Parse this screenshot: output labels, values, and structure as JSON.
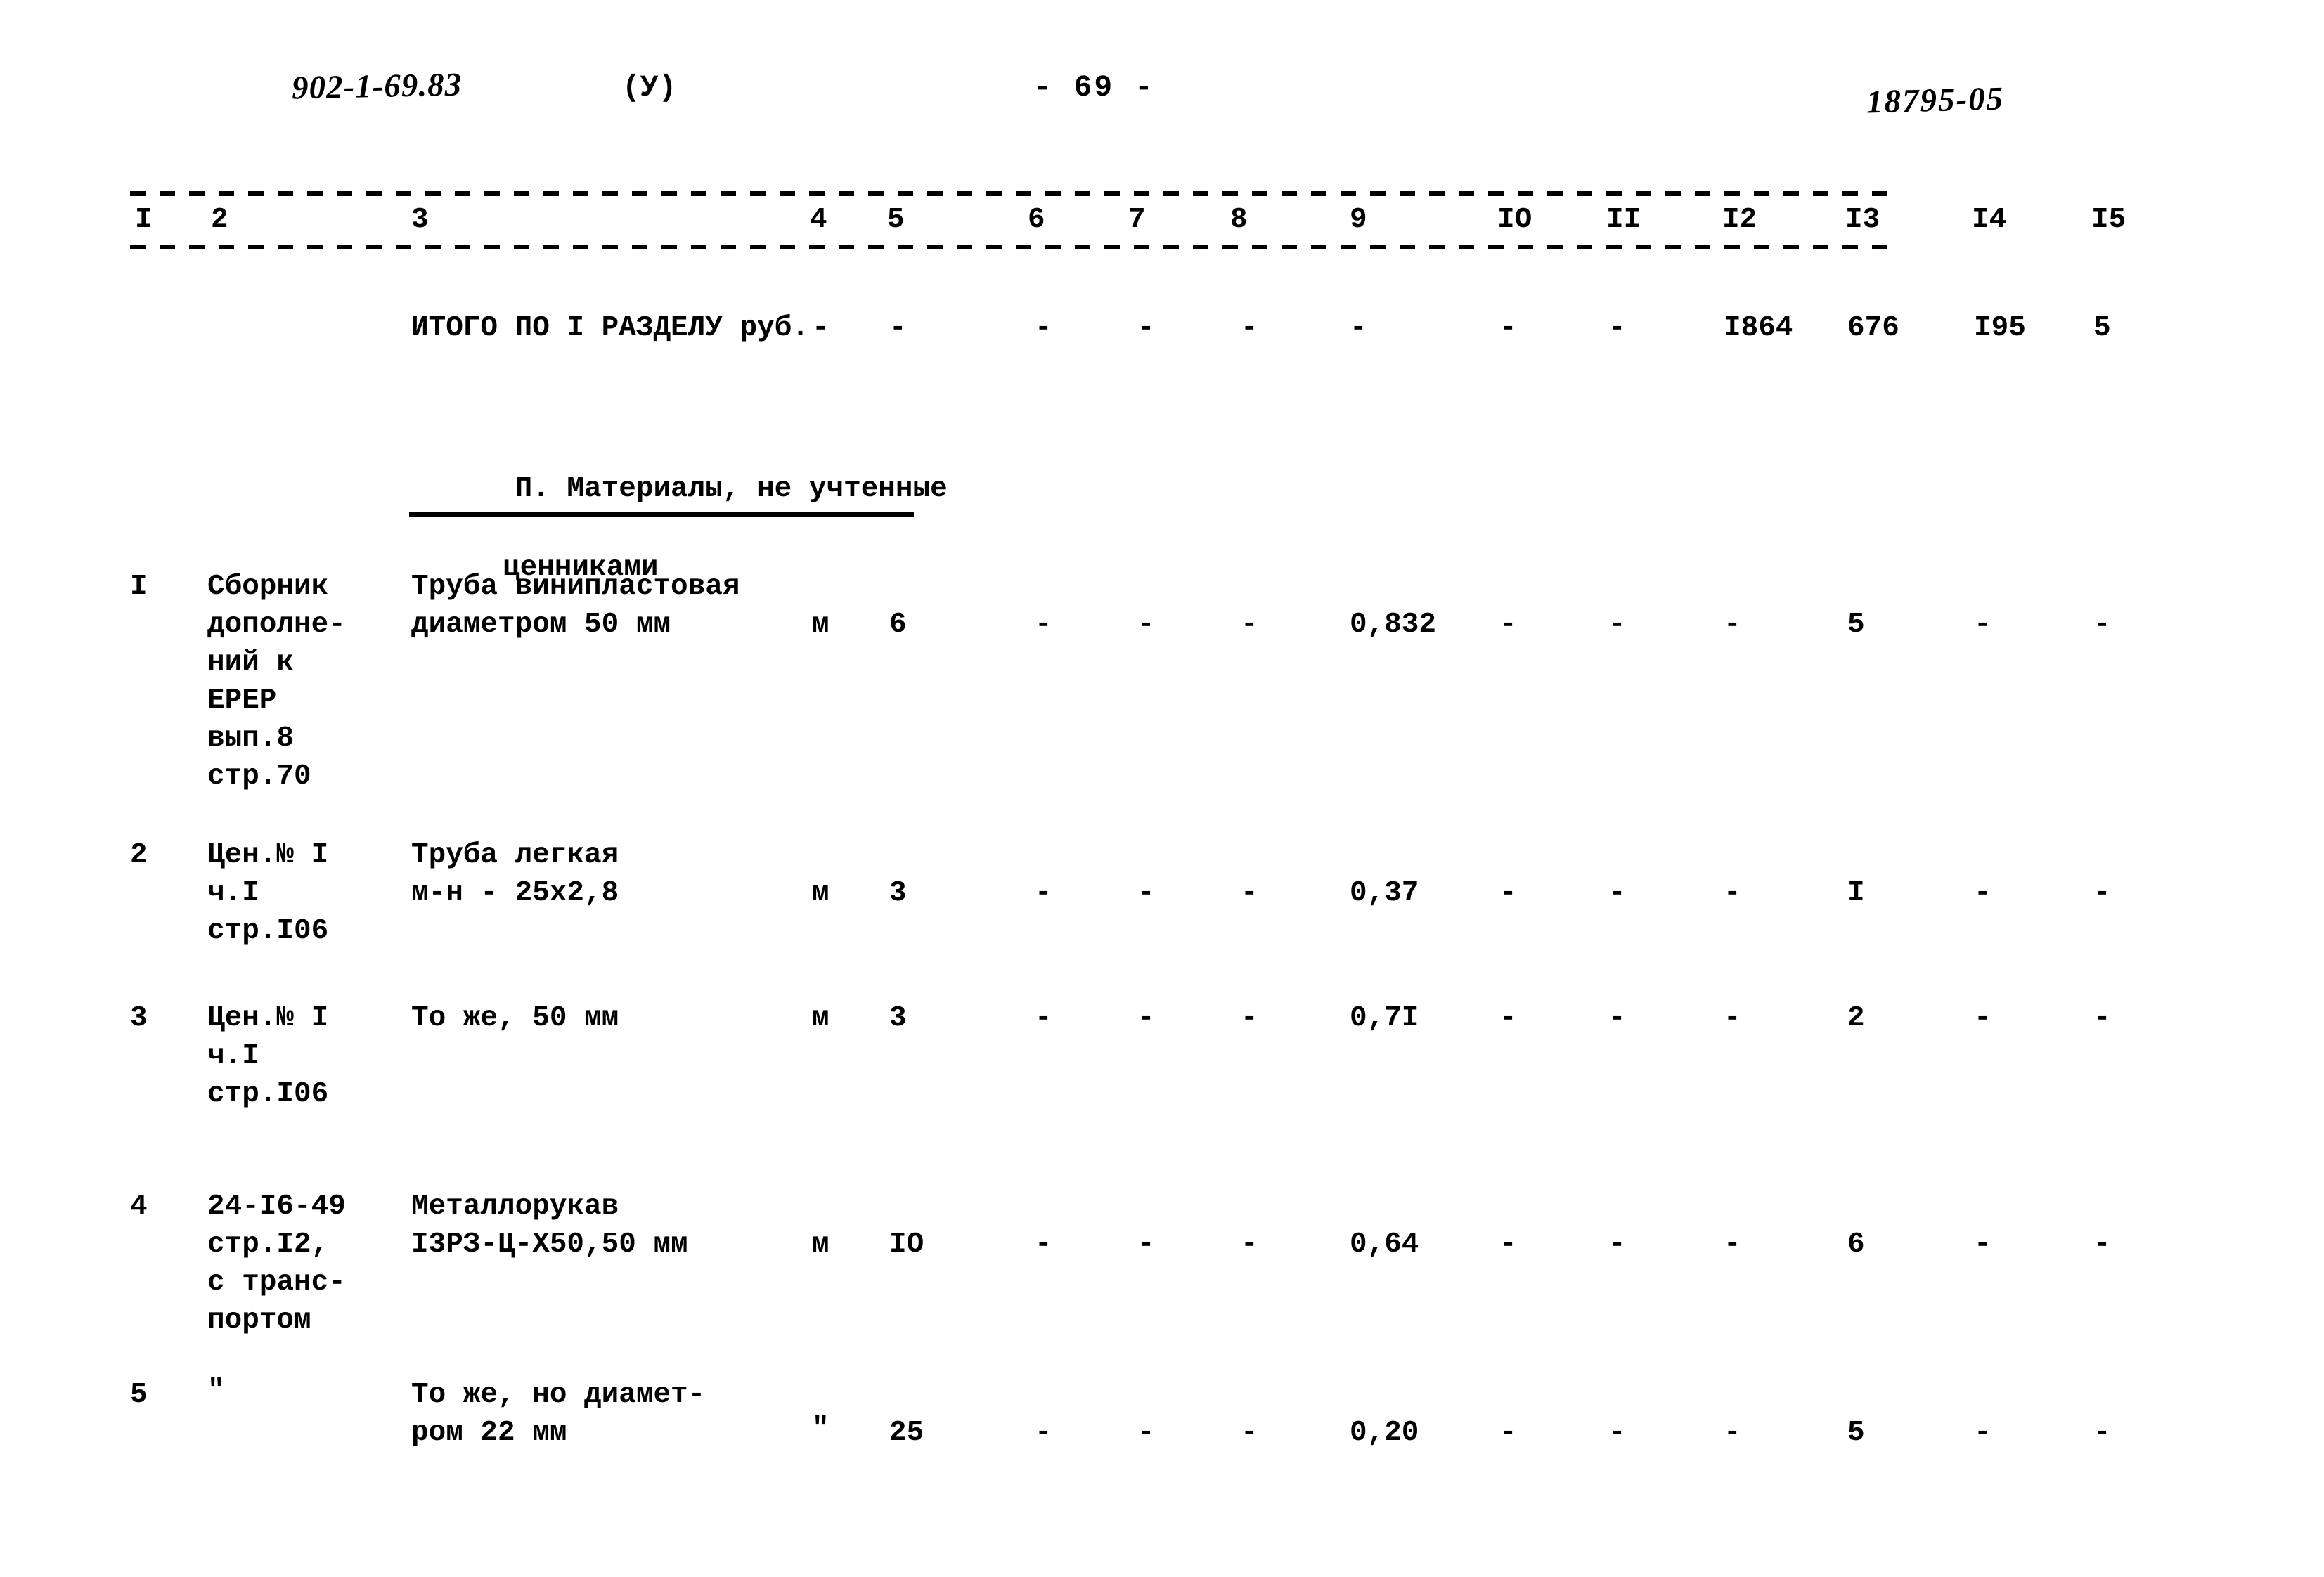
{
  "header": {
    "doc_code": "902-1-69.83",
    "doc_variant": "(У)",
    "page_number": "- 69 -",
    "archive_code": "18795-05"
  },
  "table": {
    "column_numbers": [
      "I",
      "2",
      "3",
      "4",
      "5",
      "6",
      "7",
      "8",
      "9",
      "IO",
      "II",
      "I2",
      "I3",
      "I4",
      "I5"
    ],
    "total_row": {
      "label": "ИТОГО ПО I РАЗДЕЛУ руб.",
      "c4": "-",
      "c5": "-",
      "c6": "-",
      "c7": "-",
      "c8": "-",
      "c9": "-",
      "c10": "-",
      "c11": "-",
      "c12": "I864",
      "c13": "676",
      "c14": "I95",
      "c15": "5"
    },
    "section_heading": {
      "line1": "П. Материалы, не учтенные",
      "line2": "ценниками"
    },
    "rows": [
      {
        "num": "I",
        "code": "Сборник\nдополне-\nний к\nЕРЕР\nвып.8\nстр.70",
        "desc": "Труба винипластовая\nдиаметром 50 мм",
        "unit": "м",
        "qty": "6",
        "c6": "-",
        "c7": "-",
        "c8": "-",
        "c9": "0,832",
        "c10": "-",
        "c11": "-",
        "c12": "-",
        "c13": "5",
        "c14": "-",
        "c15": "-"
      },
      {
        "num": "2",
        "code": "Цен.№ I\nч.I\nстр.I06",
        "desc": "Труба легкая\nм-н - 25х2,8",
        "unit": "м",
        "qty": "3",
        "c6": "-",
        "c7": "-",
        "c8": "-",
        "c9": "0,37",
        "c10": "-",
        "c11": "-",
        "c12": "-",
        "c13": "I",
        "c14": "-",
        "c15": "-"
      },
      {
        "num": "3",
        "code": "Цен.№ I\nч.I\nстр.I06",
        "desc": "То же, 50 мм",
        "unit": "м",
        "qty": "3",
        "c6": "-",
        "c7": "-",
        "c8": "-",
        "c9": "0,7I",
        "c10": "-",
        "c11": "-",
        "c12": "-",
        "c13": "2",
        "c14": "-",
        "c15": "-"
      },
      {
        "num": "4",
        "code": "24-I6-49\nстр.I2,\nс транс-\nпортом",
        "desc": "Металлорукав\nI3РЗ-Ц-Х50,50 мм",
        "unit": "м",
        "qty": "IO",
        "c6": "-",
        "c7": "-",
        "c8": "-",
        "c9": "0,64",
        "c10": "-",
        "c11": "-",
        "c12": "-",
        "c13": "6",
        "c14": "-",
        "c15": "-"
      },
      {
        "num": "5",
        "code": "\"",
        "desc": "То же, но диамет-\nром 22 мм",
        "unit": "\"",
        "qty": "25",
        "c6": "-",
        "c7": "-",
        "c8": "-",
        "c9": "0,20",
        "c10": "-",
        "c11": "-",
        "c12": "-",
        "c13": "5",
        "c14": "-",
        "c15": "-"
      }
    ]
  }
}
